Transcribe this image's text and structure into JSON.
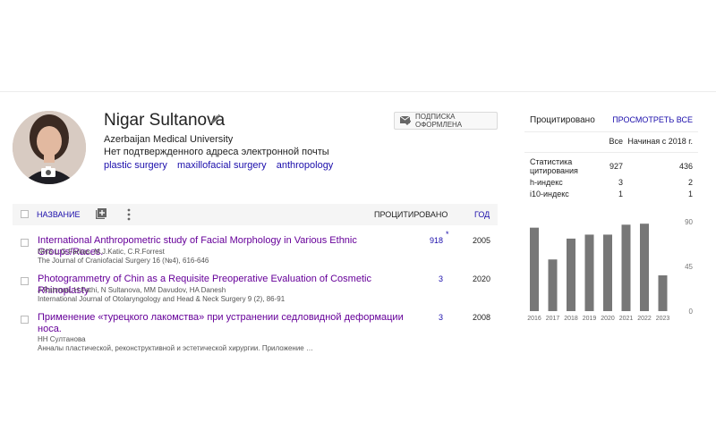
{
  "profile": {
    "name": "Nigar Sultanova",
    "affiliation": "Azerbaijan Medical University",
    "email_status": "Нет подтвержденного адреса электронной почты",
    "interests": [
      "plastic surgery",
      "maxillofacial surgery",
      "anthropology"
    ],
    "follow_label": "ПОДПИСКА ОФОРМЛЕНА"
  },
  "table": {
    "col_title": "НАЗВАНИЕ",
    "col_cited": "ПРОЦИТИРОВАНО",
    "col_year": "ГОД",
    "rows": [
      {
        "title": "International Anthropometric study of Facial Morphology in Various Ethnic Groups/Races.",
        "authors": "NNS L.G.Farkas, M.J.Katic, C.R.Forrest",
        "source": "The Journal of Craniofacial Surgery 16 (№4), 616-646",
        "cited": "918",
        "star": "*",
        "year": "2005"
      },
      {
        "title": "Photogrammetry of Chin as a Requisite Preoperative Evaluation of Cosmetic Rhinoplasty",
        "authors": "J Rahmati, H Fathi, N Sultanova, MM Davudov, HA Danesh",
        "source": "International Journal of Otolaryngology and Head & Neck Surgery 9 (2), 86-91",
        "cited": "3",
        "star": "",
        "year": "2020"
      },
      {
        "title": "Применение «турецкого лакомства» при устранении седловидной деформации носа.",
        "authors": "НН Султанова",
        "source": "Анналы пластической, реконструктивной и эстетической хирургии. Приложение …",
        "cited": "3",
        "star": "",
        "year": "2008"
      }
    ]
  },
  "cited_by": {
    "title": "Процитировано",
    "view_all": "ПРОСМОТРЕТЬ ВСЕ",
    "col_all": "Все",
    "col_since": "Начиная с 2018 г.",
    "citations_label_1": "Статистика",
    "citations_label_2": "цитирования",
    "citations_all": "927",
    "citations_since": "436",
    "h_label": "h-индекс",
    "h_all": "3",
    "h_since": "2",
    "i10_label": "i10-индекс",
    "i10_all": "1",
    "i10_since": "1"
  },
  "chart_data": {
    "type": "bar",
    "categories": [
      "2016",
      "2017",
      "2018",
      "2019",
      "2020",
      "2021",
      "2022",
      "2023"
    ],
    "values": [
      84,
      52,
      73,
      77,
      77,
      87,
      88,
      36
    ],
    "yticks": [
      0,
      45,
      90
    ],
    "ylim": [
      0,
      90
    ],
    "bar_color": "#777777",
    "grid": false
  },
  "icons": {
    "edit": "pencil-icon",
    "camera": "camera-icon",
    "follow": "mail-check-icon",
    "add": "add-box-icon",
    "more": "more-vert-icon"
  }
}
